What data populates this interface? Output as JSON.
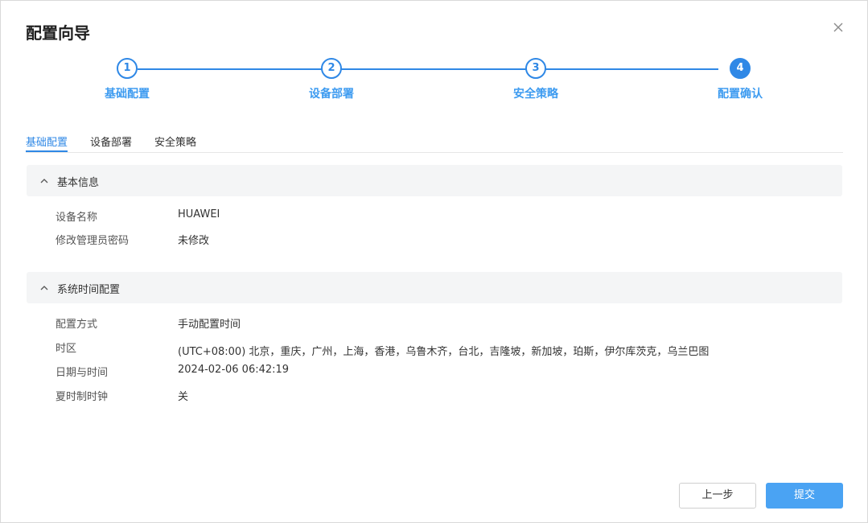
{
  "dialog": {
    "title": "配置向导"
  },
  "steps": [
    {
      "number": "1",
      "label": "基础配置"
    },
    {
      "number": "2",
      "label": "设备部署"
    },
    {
      "number": "3",
      "label": "安全策略"
    },
    {
      "number": "4",
      "label": "配置确认"
    }
  ],
  "current_step": 4,
  "tabs": [
    {
      "label": "基础配置",
      "active": true
    },
    {
      "label": "设备部署",
      "active": false
    },
    {
      "label": "安全策略",
      "active": false
    }
  ],
  "sections": [
    {
      "title": "基本信息",
      "rows": [
        {
          "key": "设备名称",
          "value": "HUAWEI"
        },
        {
          "key": "修改管理员密码",
          "value": "未修改"
        }
      ]
    },
    {
      "title": "系统时间配置",
      "rows": [
        {
          "key": "配置方式",
          "value": "手动配置时间"
        },
        {
          "key": "时区",
          "value": " (UTC+08:00) 北京，重庆，广州，上海，香港，乌鲁木齐，台北，吉隆坡，新加坡，珀斯，伊尔库茨克，乌兰巴图"
        },
        {
          "key": "日期与时间",
          "value": "2024-02-06 06:42:19"
        },
        {
          "key": "夏时制时钟",
          "value": "关"
        }
      ]
    }
  ],
  "buttons": {
    "prev": "上一步",
    "submit": "提交"
  },
  "icons": {
    "close": "close-icon",
    "collapse": "chevron-up-icon"
  },
  "colors": {
    "accent": "#2f88e6",
    "step_label": "#3d9bf0",
    "primary_button": "#4aa3f3",
    "section_bg": "#f4f5f6"
  }
}
